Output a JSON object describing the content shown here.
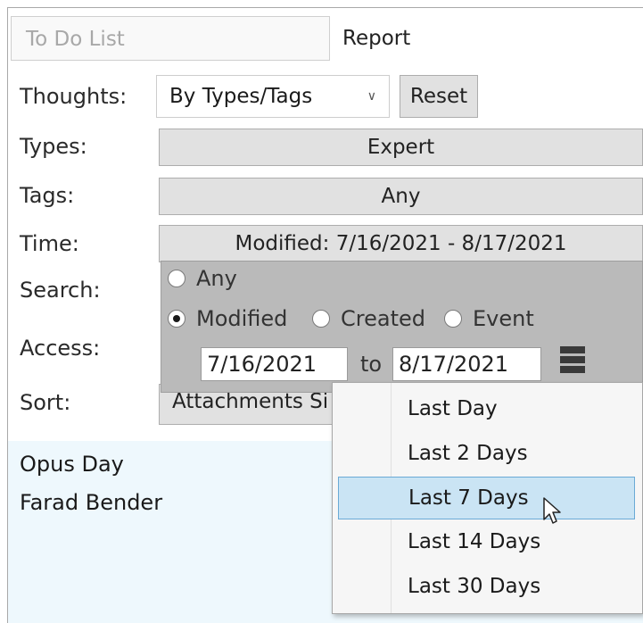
{
  "tabs": {
    "todo": "To Do List",
    "report": "Report"
  },
  "labels": {
    "thoughts": "Thoughts:",
    "types": "Types:",
    "tags": "Tags:",
    "time": "Time:",
    "search": "Search:",
    "access": "Access:",
    "sort": "Sort:"
  },
  "thoughts_select": {
    "value": "By Types/Tags"
  },
  "reset_label": "Reset",
  "types_value": "Expert",
  "tags_value": "Any",
  "time_value": "Modified: 7/16/2021 - 8/17/2021",
  "sort_value": "Attachments Si",
  "time_popup": {
    "any_label": "Any",
    "modified_label": "Modified",
    "created_label": "Created",
    "event_label": "Event",
    "from_date": "7/16/2021",
    "to_label": "to",
    "to_date": "8/17/2021",
    "selected_radio": "Modified"
  },
  "list_items": [
    "Opus Day",
    "Farad Bender"
  ],
  "range_menu": [
    "Last Day",
    "Last 2 Days",
    "Last 7 Days",
    "Last 14 Days",
    "Last 30 Days"
  ],
  "range_menu_selected": "Last 7 Days",
  "colors": {
    "list_background": "#eef8fd",
    "selection_fill": "#cae4f4",
    "selection_border": "#6aaad6",
    "popup_background": "#bababa"
  }
}
